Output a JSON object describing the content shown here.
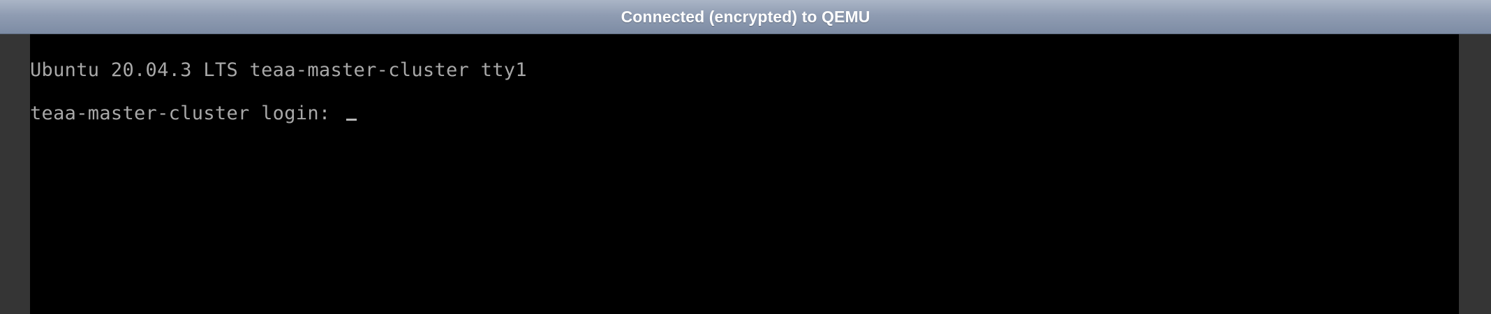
{
  "window": {
    "title": "Connected (encrypted) to QEMU"
  },
  "console": {
    "banner": "Ubuntu 20.04.3 LTS teaa-master-cluster tty1",
    "login_prompt": "teaa-master-cluster login: ",
    "text_color": "#a8a8a8",
    "background_color": "#000000"
  },
  "colors": {
    "frame": "#353535",
    "titlebar": "#8f9cb2"
  }
}
